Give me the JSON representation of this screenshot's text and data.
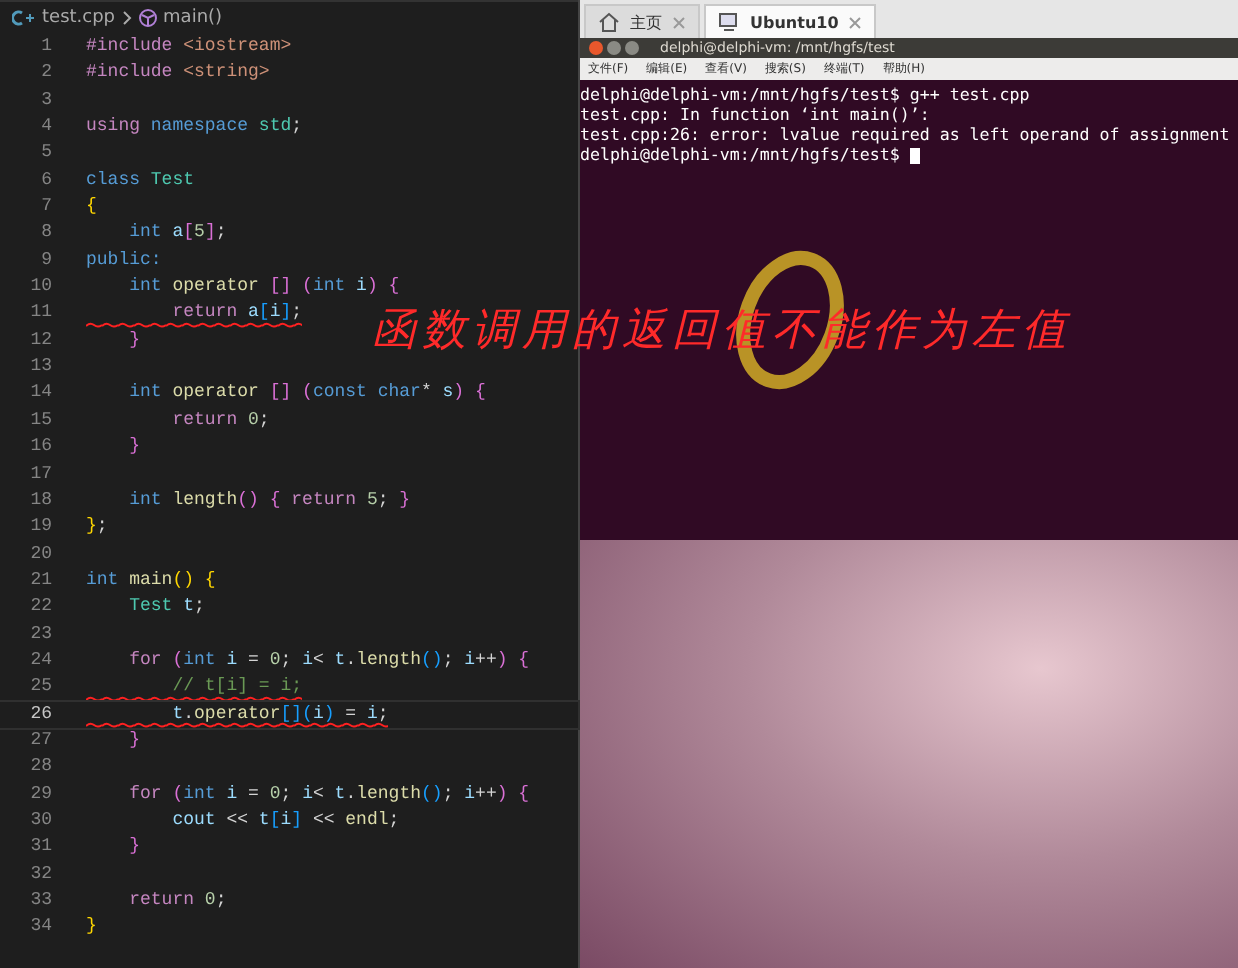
{
  "editor": {
    "breadcrumb": {
      "file": "test.cpp",
      "symbol": "main()"
    },
    "lines": [
      {
        "number": "1",
        "current": false,
        "underlined": false,
        "tokens": [
          {
            "text": "#include ",
            "kind": "control"
          },
          {
            "text": "<iostream>",
            "kind": "string"
          }
        ]
      },
      {
        "number": "2",
        "current": false,
        "underlined": false,
        "tokens": [
          {
            "text": "#include ",
            "kind": "control"
          },
          {
            "text": "<string>",
            "kind": "string"
          }
        ]
      },
      {
        "number": "3",
        "current": false,
        "underlined": false
      },
      {
        "number": "4",
        "current": false,
        "underlined": false,
        "tokens": [
          {
            "text": "using ",
            "kind": "control"
          },
          {
            "text": "namespace ",
            "kind": "keyword"
          },
          {
            "text": "std",
            "kind": "type"
          },
          {
            "text": ";",
            "kind": "plain"
          }
        ]
      },
      {
        "number": "5",
        "current": false,
        "underlined": false
      },
      {
        "number": "6",
        "current": false,
        "underlined": false,
        "tokens": [
          {
            "text": "class ",
            "kind": "keyword"
          },
          {
            "text": "Test",
            "kind": "type"
          }
        ]
      },
      {
        "number": "7",
        "current": false,
        "underlined": false,
        "tokens": [
          {
            "text": "{",
            "kind": "bracket"
          }
        ]
      },
      {
        "number": "8",
        "current": false,
        "underlined": false,
        "tokens": [
          {
            "text": "    int ",
            "kind": "keyword"
          },
          {
            "text": "a",
            "kind": "var"
          },
          {
            "text": "[",
            "kind": "bracket2"
          },
          {
            "text": "5",
            "kind": "number"
          },
          {
            "text": "]",
            "kind": "bracket2"
          },
          {
            "text": ";",
            "kind": "plain"
          }
        ]
      },
      {
        "number": "9",
        "current": false,
        "underlined": false,
        "tokens": [
          {
            "text": "public:",
            "kind": "keyword"
          }
        ]
      },
      {
        "number": "10",
        "current": false,
        "underlined": false,
        "tokens": [
          {
            "text": "    int ",
            "kind": "keyword"
          },
          {
            "text": "operator ",
            "kind": "func"
          },
          {
            "text": "[] ",
            "kind": "bracket2"
          },
          {
            "text": "(",
            "kind": "bracket2"
          },
          {
            "text": "int ",
            "kind": "keyword"
          },
          {
            "text": "i",
            "kind": "var"
          },
          {
            "text": ") {",
            "kind": "bracket2"
          }
        ]
      },
      {
        "number": "11",
        "current": false,
        "underlined": true,
        "tokens": [
          {
            "text": "        return ",
            "kind": "control"
          },
          {
            "text": "a",
            "kind": "var"
          },
          {
            "text": "[",
            "kind": "bracket3"
          },
          {
            "text": "i",
            "kind": "var"
          },
          {
            "text": "]",
            "kind": "bracket3"
          },
          {
            "text": ";",
            "kind": "plain"
          }
        ]
      },
      {
        "number": "12",
        "current": false,
        "underlined": false,
        "tokens": [
          {
            "text": "    }",
            "kind": "bracket2"
          }
        ]
      },
      {
        "number": "13",
        "current": false,
        "underlined": false
      },
      {
        "number": "14",
        "current": false,
        "underlined": false,
        "tokens": [
          {
            "text": "    int ",
            "kind": "keyword"
          },
          {
            "text": "operator ",
            "kind": "func"
          },
          {
            "text": "[] ",
            "kind": "bracket2"
          },
          {
            "text": "(",
            "kind": "bracket2"
          },
          {
            "text": "const ",
            "kind": "keyword"
          },
          {
            "text": "char",
            "kind": "keyword"
          },
          {
            "text": "* ",
            "kind": "plain"
          },
          {
            "text": "s",
            "kind": "var"
          },
          {
            "text": ") {",
            "kind": "bracket2"
          }
        ]
      },
      {
        "number": "15",
        "current": false,
        "underlined": false,
        "tokens": [
          {
            "text": "        return ",
            "kind": "control"
          },
          {
            "text": "0",
            "kind": "number"
          },
          {
            "text": ";",
            "kind": "plain"
          }
        ]
      },
      {
        "number": "16",
        "current": false,
        "underlined": false,
        "tokens": [
          {
            "text": "    }",
            "kind": "bracket2"
          }
        ]
      },
      {
        "number": "17",
        "current": false,
        "underlined": false
      },
      {
        "number": "18",
        "current": false,
        "underlined": false,
        "tokens": [
          {
            "text": "    int ",
            "kind": "keyword"
          },
          {
            "text": "length",
            "kind": "func"
          },
          {
            "text": "() { ",
            "kind": "bracket2"
          },
          {
            "text": "return ",
            "kind": "control"
          },
          {
            "text": "5",
            "kind": "number"
          },
          {
            "text": "; ",
            "kind": "plain"
          },
          {
            "text": "}",
            "kind": "bracket2"
          }
        ]
      },
      {
        "number": "19",
        "current": false,
        "underlined": false,
        "tokens": [
          {
            "text": "}",
            "kind": "bracket"
          },
          {
            "text": ";",
            "kind": "plain"
          }
        ]
      },
      {
        "number": "20",
        "current": false,
        "underlined": false
      },
      {
        "number": "21",
        "current": false,
        "underlined": false,
        "tokens": [
          {
            "text": "int ",
            "kind": "keyword"
          },
          {
            "text": "main",
            "kind": "func"
          },
          {
            "text": "() {",
            "kind": "bracket"
          }
        ]
      },
      {
        "number": "22",
        "current": false,
        "underlined": false,
        "tokens": [
          {
            "text": "    Test ",
            "kind": "type"
          },
          {
            "text": "t",
            "kind": "var"
          },
          {
            "text": ";",
            "kind": "plain"
          }
        ]
      },
      {
        "number": "23",
        "current": false,
        "underlined": false
      },
      {
        "number": "24",
        "current": false,
        "underlined": false,
        "tokens": [
          {
            "text": "    for ",
            "kind": "control"
          },
          {
            "text": "(",
            "kind": "bracket2"
          },
          {
            "text": "int ",
            "kind": "keyword"
          },
          {
            "text": "i ",
            "kind": "var"
          },
          {
            "text": "= ",
            "kind": "plain"
          },
          {
            "text": "0",
            "kind": "number"
          },
          {
            "text": "; ",
            "kind": "plain"
          },
          {
            "text": "i",
            "kind": "var"
          },
          {
            "text": "< ",
            "kind": "plain"
          },
          {
            "text": "t",
            "kind": "var"
          },
          {
            "text": ".",
            "kind": "plain"
          },
          {
            "text": "length",
            "kind": "func"
          },
          {
            "text": "()",
            "kind": "bracket3"
          },
          {
            "text": "; ",
            "kind": "plain"
          },
          {
            "text": "i",
            "kind": "var"
          },
          {
            "text": "++",
            "kind": "plain"
          },
          {
            "text": ") {",
            "kind": "bracket2"
          }
        ]
      },
      {
        "number": "25",
        "current": false,
        "underlined": true,
        "tokens": [
          {
            "text": "        // t[i] = i;",
            "kind": "comment"
          }
        ]
      },
      {
        "number": "26",
        "current": true,
        "underlined": true,
        "tokens": [
          {
            "text": "        t",
            "kind": "var"
          },
          {
            "text": ".",
            "kind": "plain"
          },
          {
            "text": "operator",
            "kind": "func"
          },
          {
            "text": "[]",
            "kind": "bracket3"
          },
          {
            "text": "(",
            "kind": "bracket3"
          },
          {
            "text": "i",
            "kind": "var"
          },
          {
            "text": ") ",
            "kind": "bracket3"
          },
          {
            "text": "= ",
            "kind": "plain"
          },
          {
            "text": "i",
            "kind": "var"
          },
          {
            "text": ";",
            "kind": "plain"
          }
        ]
      },
      {
        "number": "27",
        "current": false,
        "underlined": false,
        "tokens": [
          {
            "text": "    }",
            "kind": "bracket2"
          }
        ]
      },
      {
        "number": "28",
        "current": false,
        "underlined": false
      },
      {
        "number": "29",
        "current": false,
        "underlined": false,
        "tokens": [
          {
            "text": "    for ",
            "kind": "control"
          },
          {
            "text": "(",
            "kind": "bracket2"
          },
          {
            "text": "int ",
            "kind": "keyword"
          },
          {
            "text": "i ",
            "kind": "var"
          },
          {
            "text": "= ",
            "kind": "plain"
          },
          {
            "text": "0",
            "kind": "number"
          },
          {
            "text": "; ",
            "kind": "plain"
          },
          {
            "text": "i",
            "kind": "var"
          },
          {
            "text": "< ",
            "kind": "plain"
          },
          {
            "text": "t",
            "kind": "var"
          },
          {
            "text": ".",
            "kind": "plain"
          },
          {
            "text": "length",
            "kind": "func"
          },
          {
            "text": "()",
            "kind": "bracket3"
          },
          {
            "text": "; ",
            "kind": "plain"
          },
          {
            "text": "i",
            "kind": "var"
          },
          {
            "text": "++",
            "kind": "plain"
          },
          {
            "text": ") {",
            "kind": "bracket2"
          }
        ]
      },
      {
        "number": "30",
        "current": false,
        "underlined": false,
        "tokens": [
          {
            "text": "        cout ",
            "kind": "var"
          },
          {
            "text": "<< ",
            "kind": "plain"
          },
          {
            "text": "t",
            "kind": "var"
          },
          {
            "text": "[",
            "kind": "bracket3"
          },
          {
            "text": "i",
            "kind": "var"
          },
          {
            "text": "] ",
            "kind": "bracket3"
          },
          {
            "text": "<< ",
            "kind": "plain"
          },
          {
            "text": "endl",
            "kind": "func"
          },
          {
            "text": ";",
            "kind": "plain"
          }
        ]
      },
      {
        "number": "31",
        "current": false,
        "underlined": false,
        "tokens": [
          {
            "text": "    }",
            "kind": "bracket2"
          }
        ]
      },
      {
        "number": "32",
        "current": false,
        "underlined": false
      },
      {
        "number": "33",
        "current": false,
        "underlined": false,
        "tokens": [
          {
            "text": "    return ",
            "kind": "control"
          },
          {
            "text": "0",
            "kind": "number"
          },
          {
            "text": ";",
            "kind": "plain"
          }
        ]
      },
      {
        "number": "34",
        "current": false,
        "underlined": false,
        "tokens": [
          {
            "text": "}",
            "kind": "bracket"
          }
        ]
      }
    ]
  },
  "vm": {
    "tabs": [
      {
        "label": "主页",
        "selected": false
      },
      {
        "label": "Ubuntu10",
        "selected": true
      }
    ],
    "terminal": {
      "title": "delphi@delphi-vm: /mnt/hgfs/test",
      "menu": [
        "文件(F)",
        "编辑(E)",
        "查看(V)",
        "搜索(S)",
        "终端(T)",
        "帮助(H)"
      ],
      "lines": [
        "delphi@delphi-vm:/mnt/hgfs/test$ g++ test.cpp",
        "test.cpp: In function ‘int main()’:",
        "test.cpp:26: error: lvalue required as left operand of assignment",
        "delphi@delphi-vm:/mnt/hgfs/test$ "
      ]
    }
  },
  "annotation": {
    "text": "函数调用的返回值不能作为左值"
  }
}
